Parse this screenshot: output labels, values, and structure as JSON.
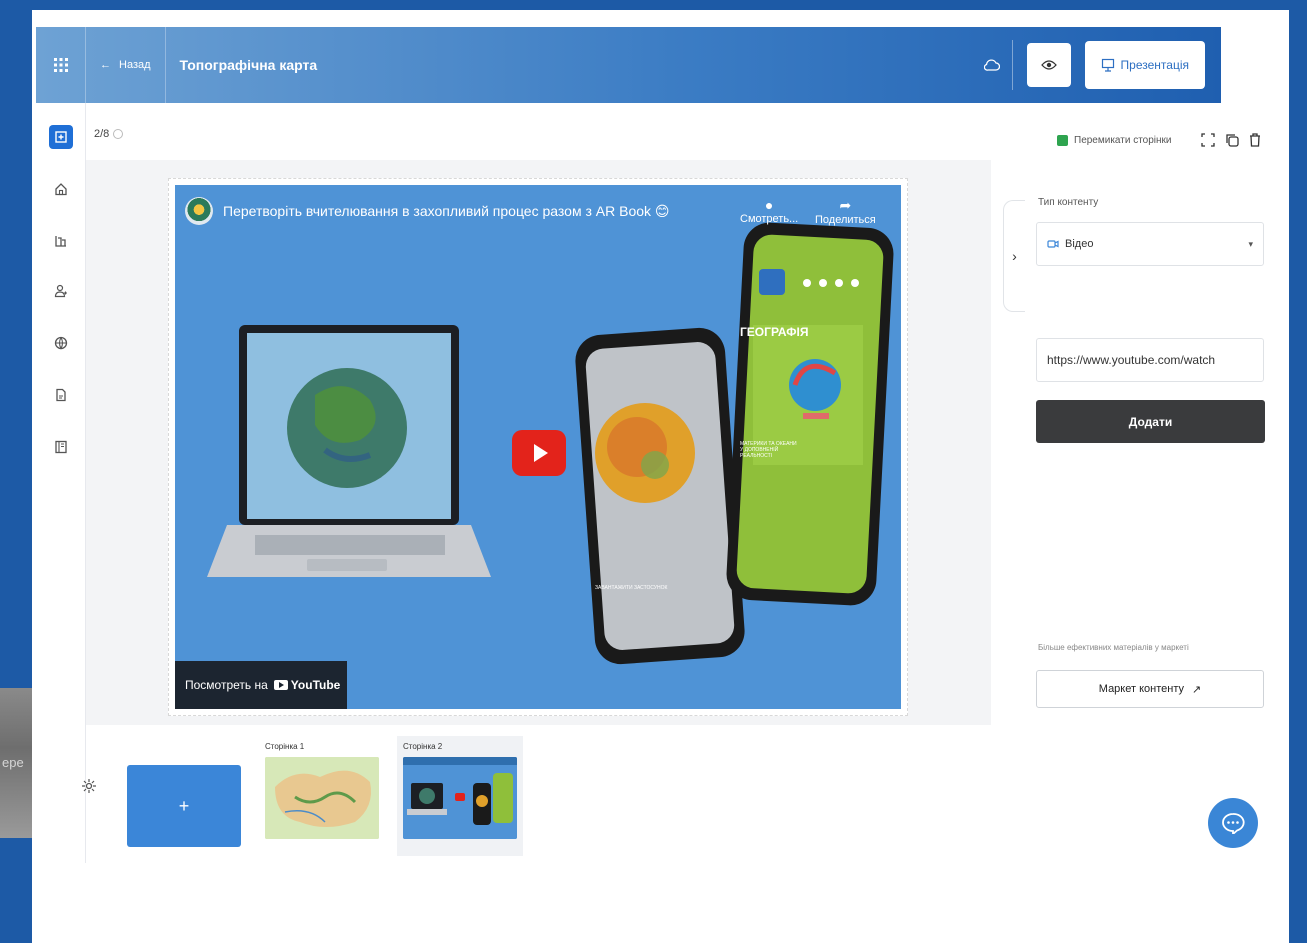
{
  "backdrop": {
    "partial_text": "ере"
  },
  "header": {
    "back_label": "Назад",
    "title": "Топографічна карта",
    "present_label": "Презентація"
  },
  "sidebar": {
    "items": [
      "add-icon",
      "home-icon",
      "library-icon",
      "users-icon",
      "globe-icon",
      "document-icon",
      "book-icon"
    ]
  },
  "page_counter": "2/8",
  "video": {
    "title": "Перетворіть вчителювання в захопливий процес разом з AR Book 😊",
    "watch_label": "Смотреть...",
    "share_label": "Поделиться",
    "watch_on_label": "Посмотреть на",
    "youtube_label": "YouTube",
    "phone_caption": "ГЕОГРАФІЯ",
    "phone_subcaption": "МАТЕРИКИ ТА ОКЕАНИ У ДОПОВНЕНІЙ РЕАЛЬНОСТІ",
    "phone_small_caption": "ЗАВАНТАЖИТИ ЗАСТОСУНОК"
  },
  "right_panel": {
    "swap_label": "Перемикати сторінки",
    "content_type_label": "Тип контенту",
    "content_type_value": "Відео",
    "url_value": "https://www.youtube.com/watch",
    "add_button": "Додати",
    "market_hint": "Більше ефективних матеріалів у маркеті",
    "market_button": "Маркет контенту"
  },
  "slides": [
    {
      "label": "Сторінка 1"
    },
    {
      "label": "Сторінка 2"
    }
  ],
  "add_slide_label": "+",
  "colors": {
    "page_bg": "#1d5aa6",
    "accent": "#3b86d8",
    "dark_button": "#3a3b3d",
    "check_green": "#2ea44f",
    "play_red": "#e3231b"
  }
}
